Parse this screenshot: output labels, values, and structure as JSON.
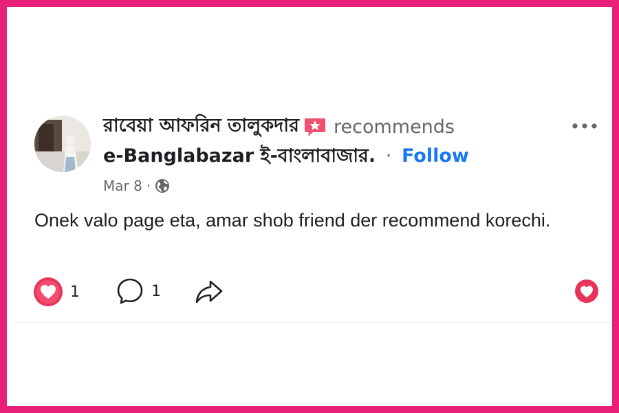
{
  "post": {
    "author_name": "রাবেয়া আফরিন তালুকদার",
    "recommends_label": "recommends",
    "page_name": "e-Banglabazar ই-বাংলাবাজার.",
    "separator": "·",
    "follow_label": "Follow",
    "date": "Mar 8",
    "date_separator": "·",
    "privacy_icon": "globe-icon",
    "text": "Onek valo page eta, amar shob friend der recommend korechi.",
    "recommend_icon": "star-badge-icon"
  },
  "actions": {
    "like_count": "1",
    "comment_count": "1",
    "like_icon": "heart-icon",
    "comment_icon": "comment-bubble-icon",
    "share_icon": "share-arrow-icon",
    "side_icon": "heart-icon"
  },
  "colors": {
    "frame_border": "#e8207a",
    "follow_link": "#1877f2",
    "heart": "#e8345b",
    "secondary_text": "#65676b"
  }
}
